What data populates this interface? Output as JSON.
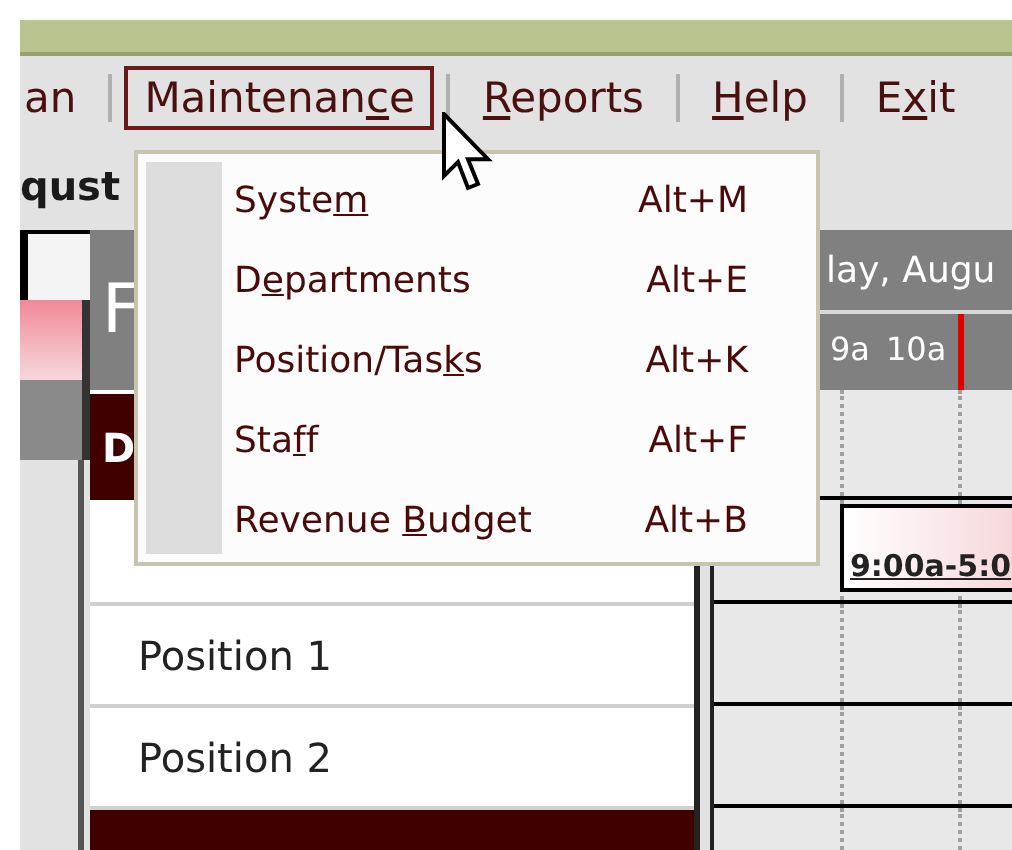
{
  "menu_bar": [
    {
      "label_parts": [
        "an"
      ],
      "selected": false
    },
    {
      "label_parts": [
        "Maintenan",
        "c",
        "e"
      ],
      "selected": true
    },
    {
      "label_parts": [
        "R",
        "eports"
      ],
      "selected": false
    },
    {
      "label_parts": [
        "H",
        "elp"
      ],
      "selected": false
    },
    {
      "label_parts": [
        "E",
        "x",
        "it"
      ],
      "selected": false
    }
  ],
  "date_fragment": "qust",
  "dropdown": {
    "items": [
      {
        "label_parts": [
          "Syste",
          "m"
        ],
        "shortcut": "Alt+M"
      },
      {
        "label_parts": [
          "D",
          "e",
          "partments"
        ],
        "shortcut": "Alt+E"
      },
      {
        "label_parts": [
          "Position/Tas",
          "k",
          "s"
        ],
        "shortcut": "Alt+K"
      },
      {
        "label_parts": [
          "Sta",
          "f",
          "f"
        ],
        "shortcut": "Alt+F"
      },
      {
        "label_parts": [
          "Revenue ",
          "B",
          "udget"
        ],
        "shortcut": "Alt+B"
      }
    ]
  },
  "staff_panel": {
    "header": "F",
    "department": "D",
    "rows": [
      "Position 1",
      "Position 2"
    ]
  },
  "schedule": {
    "date": "lay, Augu",
    "hours": [
      "9a",
      "10a"
    ],
    "shift": "9:00a-5:0"
  }
}
